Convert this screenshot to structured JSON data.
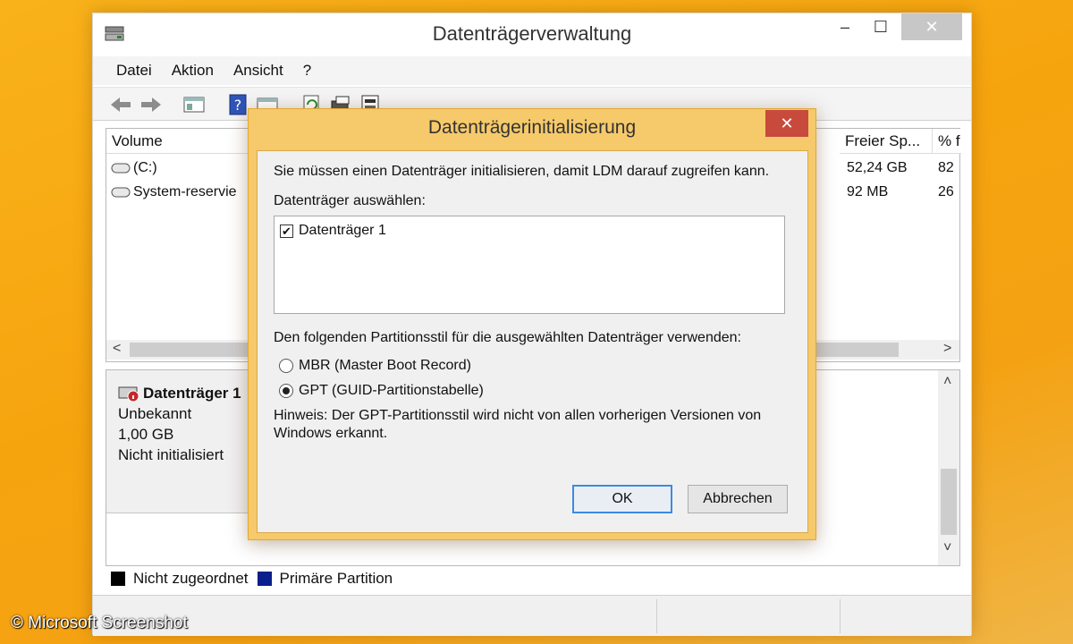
{
  "window": {
    "title": "Datenträgerverwaltung",
    "minimize_glyph": "–",
    "maximize_glyph": "☐",
    "close_glyph": "✕"
  },
  "menu": [
    "Datei",
    "Aktion",
    "Ansicht",
    "?"
  ],
  "toolbar_icons": [
    "back-arrow-icon",
    "forward-arrow-icon",
    "console-tree-icon",
    "help-icon",
    "properties-icon",
    "refresh-icon",
    "rescan-icon",
    "disk-settings-icon"
  ],
  "volume_list": {
    "columns": [
      "Volume",
      "Freier Sp...",
      "% f"
    ],
    "rows": [
      {
        "volume": "(C:)",
        "free": "52,24 GB",
        "pct": "82"
      },
      {
        "volume": "System-reservie",
        "free": "92 MB",
        "pct": "26"
      }
    ],
    "scroll_left": "<",
    "scroll_right": ">"
  },
  "disk": {
    "name": "Datenträger 1",
    "type": "Unbekannt",
    "size": "1,00 GB",
    "status": "Nicht initialisiert",
    "scroll_up": "˄",
    "scroll_down": "˅"
  },
  "legend": [
    {
      "label": "Nicht zugeordnet",
      "color": "#000000"
    },
    {
      "label": "Primäre Partition",
      "color": "#0a1f8c"
    }
  ],
  "dialog": {
    "title": "Datenträgerinitialisierung",
    "close_glyph": "✕",
    "intro": "Sie müssen einen Datenträger initialisieren, damit LDM darauf zugreifen kann.",
    "select_label": "Datenträger auswählen:",
    "disk_items": [
      {
        "label": "Datenträger 1",
        "checked": true,
        "check_glyph": "✔"
      }
    ],
    "style_label": "Den folgenden Partitionsstil für die ausgewählten Datenträger verwenden:",
    "options": [
      {
        "label": "MBR (Master Boot Record)",
        "selected": false
      },
      {
        "label": "GPT (GUID-Partitionstabelle)",
        "selected": true
      }
    ],
    "note_line1": "Hinweis: Der GPT-Partitionsstil wird nicht von allen vorherigen Versionen von",
    "note_line2": "Windows erkannt.",
    "ok_label": "OK",
    "cancel_label": "Abbrechen"
  },
  "watermark": "© Microsoft Screenshot",
  "colors": {
    "dialog_frame": "#f6c96a",
    "dialog_close": "#c74a3c",
    "default_button_border": "#3c8ae0",
    "desktop": "#f6a40e"
  }
}
